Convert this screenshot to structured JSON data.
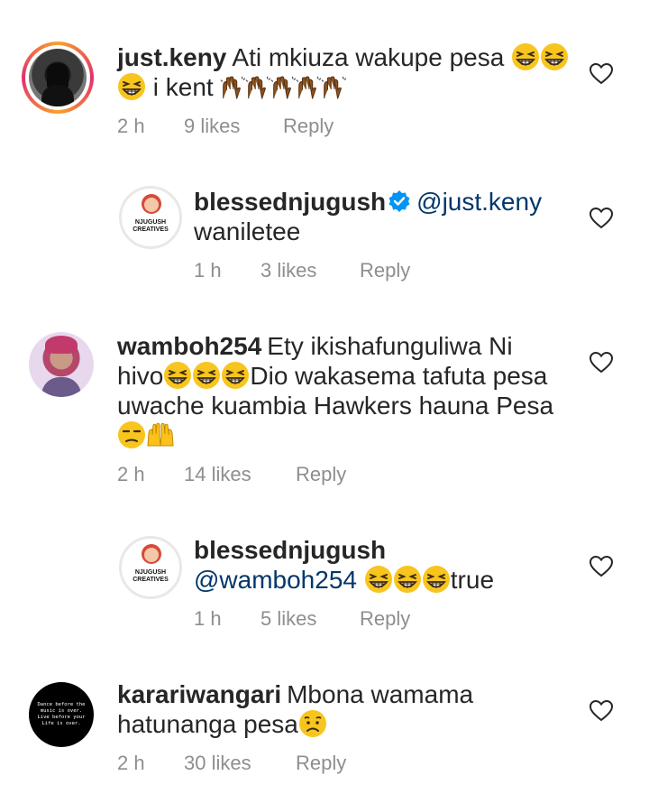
{
  "comments": [
    {
      "username": "just.keny",
      "text_parts": [
        "Ati mkiuza wakupe pesa ",
        " i kent "
      ],
      "time": "2 h",
      "likes": "9 likes",
      "reply": "Reply"
    },
    {
      "username": "blessednjugush",
      "mention": "@just.keny",
      "text": "wanileteе",
      "time": "1 h",
      "likes": "3 likes",
      "reply": "Reply",
      "avatar_text": "NJUGUSH CREATIVES"
    },
    {
      "username": "wamboh254",
      "text_parts": [
        "Ety ikishafunguliwa Ni",
        "hivo",
        "Dio wakasema tafuta pesa",
        "uwache kuambia Hawkers hauna Pesa"
      ],
      "time": "2 h",
      "likes": "14 likes",
      "reply": "Reply"
    },
    {
      "username": "blessednjugush",
      "mention": "@wamboh254",
      "text": "true",
      "time": "1 h",
      "likes": "5 likes",
      "reply": "Reply",
      "avatar_text": "NJUGUSH CREATIVES"
    },
    {
      "username": "karariwangari",
      "text_parts": [
        "Mbona wamama",
        "hatunanga pesa"
      ],
      "time": "2 h",
      "likes": "30 likes",
      "reply": "Reply",
      "avatar_text": "Dance before the music is over. Live before your Life is over."
    }
  ],
  "colors": {
    "text": "#262626",
    "meta": "#8e8e8e",
    "mention": "#00376b",
    "verified": "#0095f6",
    "story_ring": "#e1306c"
  },
  "icons": [
    "heart-outline-icon",
    "verified-badge-icon",
    "grinning-squint-emoji",
    "raised-hands-emoji",
    "unamused-emoji",
    "sad-emoji"
  ]
}
